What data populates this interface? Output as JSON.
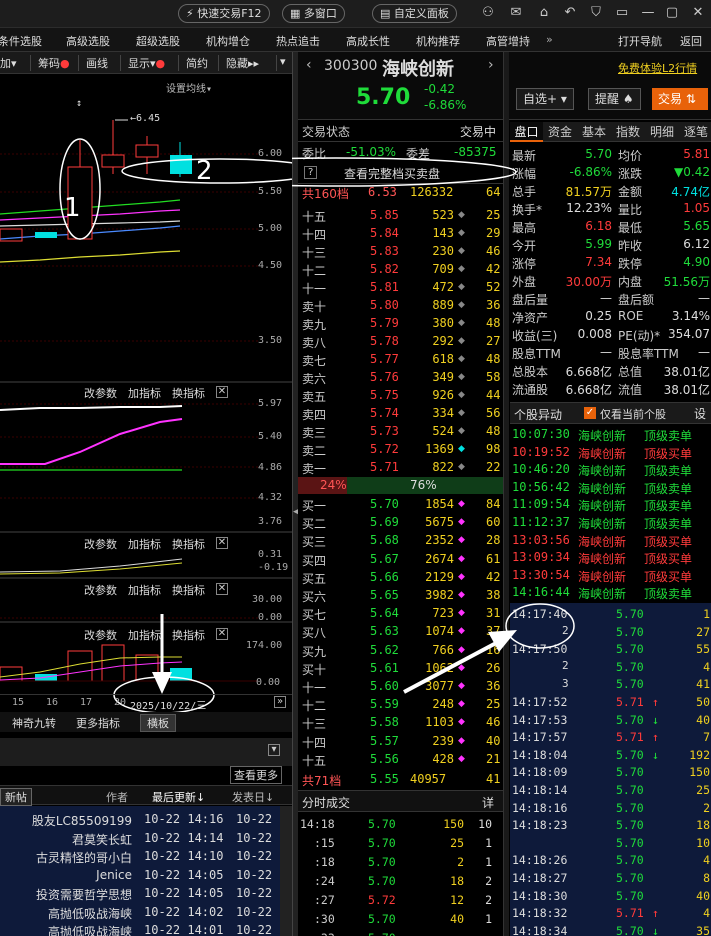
{
  "topbar": {
    "quick_trade": "快速交易F12",
    "multi_window": "多窗口",
    "custom_panel": "自定义面板"
  },
  "menu": [
    "条件选股",
    "高级选股",
    "超级选股",
    "机构增仓",
    "热点追击",
    "高成长性",
    "机构推荐",
    "高管增持",
    "打开导航",
    "返回"
  ],
  "toolbar": {
    "add": "加",
    "chips": "筹码",
    "draw": "画线",
    "show": "显示",
    "simple": "简约",
    "hide": "隐藏"
  },
  "chart": {
    "ma_setting": "设置均线",
    "high_label": "6.45",
    "price_axis": [
      "6.00",
      "5.50",
      "5.00",
      "4.50",
      "3.50"
    ],
    "panel2_axis": [
      "5.97",
      "5.40",
      "4.86",
      "4.32",
      "3.76"
    ],
    "panel3_axis": [
      "0.31",
      "-0.19"
    ],
    "panel4_axis": [
      "30.00",
      "0.00"
    ],
    "panel5_axis": [
      "174.00",
      "0.00"
    ],
    "param_edit": "改参数",
    "add_indicator": "加指标",
    "switch_indicator": "换指标",
    "x_labels": [
      "15",
      "16",
      "17",
      "20"
    ],
    "date_box": "2025/10/22/三",
    "bottom_tabs": [
      "神奇九转",
      "更多指标",
      "横板"
    ],
    "annot1": "1",
    "annot2": "2"
  },
  "forum": {
    "more": "查看更多",
    "post_col": "新帖",
    "author": "作者",
    "last_update": "最后更新",
    "post_date": "发表日",
    "rows": [
      {
        "author": "股友LC85509199",
        "upd": "10-22 14:16",
        "date": "10-22"
      },
      {
        "author": "君莫笑长虹",
        "upd": "10-22 14:14",
        "date": "10-22"
      },
      {
        "author": "古灵精怪的哥小白",
        "upd": "10-22 14:10",
        "date": "10-22"
      },
      {
        "author": "Jenice",
        "upd": "10-22 14:05",
        "date": "10-22"
      },
      {
        "author": "投资需要哲学思想",
        "upd": "10-22 14:05",
        "date": "10-22"
      },
      {
        "author": "高抛低吸战海峡",
        "upd": "10-22 14:02",
        "date": "10-22"
      },
      {
        "author": "高抛低吸战海峡",
        "upd": "10-22 14:01",
        "date": "10-22"
      }
    ]
  },
  "stock": {
    "code": "300300",
    "name": "海峡创新",
    "price": "5.70",
    "change": "-0.42",
    "pct": "-6.86%",
    "free_l2": "免费体验L2行情",
    "btn_watch": "自选+",
    "btn_alert": "提醒",
    "btn_trade": "交易"
  },
  "orderbook": {
    "status": "交易状态",
    "status_val": "交易中",
    "ratio_label": "委比",
    "ratio": "-51.03%",
    "diff_label": "委差",
    "diff": "-85375",
    "show_full": "查看完整档买卖盘",
    "ask_total_label": "共160档",
    "ask_total_price": "6.53",
    "ask_total_vol": "126332",
    "ask_total_n": "64",
    "asks": [
      {
        "l": "十五",
        "p": "5.85",
        "v": "523",
        "n": "25"
      },
      {
        "l": "十四",
        "p": "5.84",
        "v": "143",
        "n": "29"
      },
      {
        "l": "十三",
        "p": "5.83",
        "v": "230",
        "n": "46"
      },
      {
        "l": "十二",
        "p": "5.82",
        "v": "709",
        "n": "42"
      },
      {
        "l": "十一",
        "p": "5.81",
        "v": "472",
        "n": "52"
      },
      {
        "l": "卖十",
        "p": "5.80",
        "v": "889",
        "n": "36"
      },
      {
        "l": "卖九",
        "p": "5.79",
        "v": "380",
        "n": "48"
      },
      {
        "l": "卖八",
        "p": "5.78",
        "v": "292",
        "n": "27"
      },
      {
        "l": "卖七",
        "p": "5.77",
        "v": "618",
        "n": "48"
      },
      {
        "l": "卖六",
        "p": "5.76",
        "v": "349",
        "n": "58"
      },
      {
        "l": "卖五",
        "p": "5.75",
        "v": "926",
        "n": "44"
      },
      {
        "l": "卖四",
        "p": "5.74",
        "v": "334",
        "n": "56"
      },
      {
        "l": "卖三",
        "p": "5.73",
        "v": "524",
        "n": "48"
      },
      {
        "l": "卖二",
        "p": "5.72",
        "v": "1369",
        "n": "98"
      },
      {
        "l": "卖一",
        "p": "5.71",
        "v": "822",
        "n": "22"
      }
    ],
    "buy_pct": "24%",
    "sell_pct": "76%",
    "buy_ratio": 0.24,
    "bids": [
      {
        "l": "买一",
        "p": "5.70",
        "v": "1854",
        "n": "84"
      },
      {
        "l": "买二",
        "p": "5.69",
        "v": "5675",
        "n": "60"
      },
      {
        "l": "买三",
        "p": "5.68",
        "v": "2352",
        "n": "28"
      },
      {
        "l": "买四",
        "p": "5.67",
        "v": "2674",
        "n": "61"
      },
      {
        "l": "买五",
        "p": "5.66",
        "v": "2129",
        "n": "42"
      },
      {
        "l": "买六",
        "p": "5.65",
        "v": "3982",
        "n": "38"
      },
      {
        "l": "买七",
        "p": "5.64",
        "v": "723",
        "n": "31"
      },
      {
        "l": "买八",
        "p": "5.63",
        "v": "1074",
        "n": "37"
      },
      {
        "l": "买九",
        "p": "5.62",
        "v": "766",
        "n": "16"
      },
      {
        "l": "买十",
        "p": "5.61",
        "v": "1062",
        "n": "26"
      },
      {
        "l": "十一",
        "p": "5.60",
        "v": "3077",
        "n": "36"
      },
      {
        "l": "十二",
        "p": "5.59",
        "v": "248",
        "n": "25"
      },
      {
        "l": "十三",
        "p": "5.58",
        "v": "1103",
        "n": "46"
      },
      {
        "l": "十四",
        "p": "5.57",
        "v": "239",
        "n": "40"
      },
      {
        "l": "十五",
        "p": "5.56",
        "v": "428",
        "n": "21"
      }
    ],
    "bid_total_label": "共71档",
    "bid_total_price": "5.55",
    "bid_total_vol": "40957",
    "bid_total_n": "41"
  },
  "ticks": {
    "title": "分时成交",
    "detail": "详",
    "rows": [
      {
        "t": "14:18",
        "p": "5.70",
        "v": "150",
        "n": "10"
      },
      {
        "t": ":15",
        "p": "5.70",
        "v": "25",
        "n": "1"
      },
      {
        "t": ":18",
        "p": "5.70",
        "v": "2",
        "n": "1"
      },
      {
        "t": ":24",
        "p": "5.70",
        "v": "18",
        "n": "2"
      },
      {
        "t": ":27",
        "p": "5.72",
        "v": "12",
        "n": "2"
      },
      {
        "t": ":30",
        "p": "5.70",
        "v": "40",
        "n": "1"
      },
      {
        "t": ":33",
        "p": "5.70",
        "v": "",
        "n": ""
      }
    ]
  },
  "quote": {
    "tabs": [
      "盘口",
      "资金",
      "基本",
      "指数",
      "明细",
      "逐笔"
    ],
    "rows": [
      [
        "最新",
        "5.70",
        "均价",
        "5.81"
      ],
      [
        "涨幅",
        "-6.86%",
        "涨跌",
        "▼0.42"
      ],
      [
        "总手",
        "81.57万",
        "金额",
        "4.74亿"
      ],
      [
        "换手*",
        "12.23%",
        "量比",
        "1.05"
      ],
      [
        "最高",
        "6.18",
        "最低",
        "5.65"
      ],
      [
        "今开",
        "5.99",
        "昨收",
        "6.12"
      ],
      [
        "涨停",
        "7.34",
        "跌停",
        "4.90"
      ],
      [
        "外盘",
        "30.00万",
        "内盘",
        "51.56万"
      ],
      [
        "盘后量",
        "—",
        "盘后额",
        "—"
      ],
      [
        "净资产",
        "0.25",
        "ROE",
        "3.14%"
      ],
      [
        "收益(三)",
        "0.008",
        "PE(动)*",
        "354.07"
      ],
      [
        "股息TTM",
        "—",
        "股息率TTM",
        "—"
      ],
      [
        "总股本",
        "6.668亿",
        "总值",
        "38.01亿"
      ],
      [
        "流通股",
        "6.668亿",
        "流值",
        "38.01亿"
      ]
    ]
  },
  "alerts": {
    "title": "个股异动",
    "only_current": "仅看当前个股",
    "settings": "设",
    "rows": [
      {
        "t": "10:07:30",
        "s": "海峡创新",
        "e": "顶级卖单",
        "c": "g"
      },
      {
        "t": "10:19:52",
        "s": "海峡创新",
        "e": "顶级买单",
        "c": "r"
      },
      {
        "t": "10:46:20",
        "s": "海峡创新",
        "e": "顶级卖单",
        "c": "g"
      },
      {
        "t": "10:56:42",
        "s": "海峡创新",
        "e": "顶级卖单",
        "c": "g"
      },
      {
        "t": "11:09:54",
        "s": "海峡创新",
        "e": "顶级卖单",
        "c": "g"
      },
      {
        "t": "11:12:37",
        "s": "海峡创新",
        "e": "顶级卖单",
        "c": "g"
      },
      {
        "t": "13:03:56",
        "s": "海峡创新",
        "e": "顶级买单",
        "c": "r"
      },
      {
        "t": "13:09:34",
        "s": "海峡创新",
        "e": "顶级买单",
        "c": "r"
      },
      {
        "t": "13:30:54",
        "s": "海峡创新",
        "e": "顶级买单",
        "c": "r"
      },
      {
        "t": "14:16:44",
        "s": "海峡创新",
        "e": "顶级卖单",
        "c": "g"
      }
    ]
  },
  "trades": {
    "rows": [
      {
        "t": "14:17:40",
        "p": "5.70",
        "a": "",
        "v": "1"
      },
      {
        "t": "",
        "p": "5.70",
        "a": "",
        "v": "27"
      },
      {
        "t": "14:17:50",
        "p": "5.70",
        "a": "",
        "v": "55"
      },
      {
        "t": "",
        "p": "5.70",
        "a": "",
        "v": "4"
      },
      {
        "t": "",
        "p": "5.70",
        "a": "",
        "v": "41"
      },
      {
        "t": "14:17:52",
        "p": "5.71",
        "a": "up",
        "v": "50"
      },
      {
        "t": "14:17:53",
        "p": "5.70",
        "a": "down",
        "v": "40"
      },
      {
        "t": "14:17:57",
        "p": "5.71",
        "a": "up",
        "v": "7"
      },
      {
        "t": "14:18:04",
        "p": "5.70",
        "a": "down",
        "v": "192"
      },
      {
        "t": "14:18:09",
        "p": "5.70",
        "a": "",
        "v": "150"
      },
      {
        "t": "14:18:14",
        "p": "5.70",
        "a": "",
        "v": "25"
      },
      {
        "t": "14:18:16",
        "p": "5.70",
        "a": "",
        "v": "2"
      },
      {
        "t": "14:18:23",
        "p": "5.70",
        "a": "",
        "v": "18"
      },
      {
        "t": "",
        "p": "5.70",
        "a": "",
        "v": "10"
      },
      {
        "t": "14:18:26",
        "p": "5.70",
        "a": "",
        "v": "4"
      },
      {
        "t": "14:18:27",
        "p": "5.70",
        "a": "",
        "v": "8"
      },
      {
        "t": "14:18:30",
        "p": "5.70",
        "a": "",
        "v": "40"
      },
      {
        "t": "14:18:32",
        "p": "5.71",
        "a": "up",
        "v": "4"
      },
      {
        "t": "14:18:34",
        "p": "5.70",
        "a": "down",
        "v": "35"
      }
    ],
    "small_labels": [
      "2",
      "2",
      "3"
    ]
  }
}
